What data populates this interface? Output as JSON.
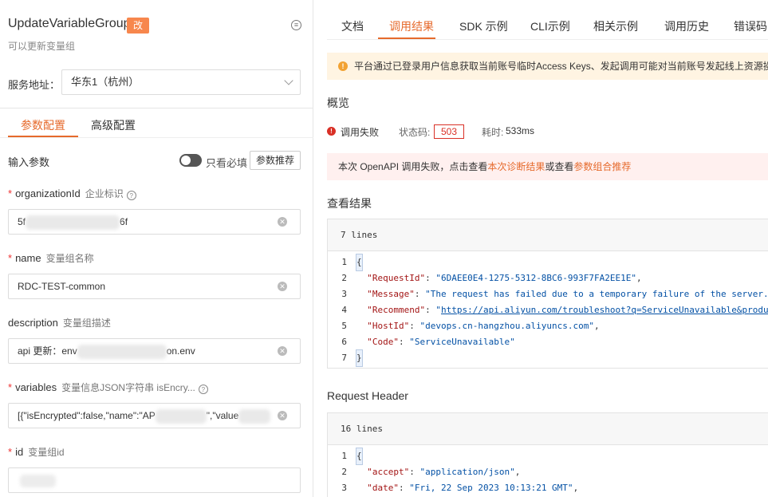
{
  "left": {
    "api_name": "UpdateVariableGroup",
    "tag": "改",
    "description": "可以更新变量组",
    "service": {
      "label": "服务地址：",
      "value": "华东1（杭州）"
    },
    "tabs": [
      "参数配置",
      "高级配置"
    ],
    "input_title": "输入参数",
    "required_only": "只看必填",
    "recommend_button": "参数推荐",
    "params": [
      {
        "required": true,
        "name": "organizationId",
        "desc": "企业标识",
        "help": true,
        "value_start": "5f",
        "value_end": "6f"
      },
      {
        "required": true,
        "name": "name",
        "desc": "变量组名称",
        "help": false,
        "value_start": "RDC-TEST-common",
        "value_end": ""
      },
      {
        "required": false,
        "name": "description",
        "desc": "变量组描述",
        "help": false,
        "value_start": "api 更新：env",
        "value_end": "on.env"
      },
      {
        "required": true,
        "name": "variables",
        "desc": "变量信息JSON字符串 isEncry...",
        "help": true,
        "value_start": "[{\"isEncrypted\":false,\"name\":\"AP",
        "value_mid": "\",\"value",
        "value_end": ""
      },
      {
        "required": true,
        "name": "id",
        "desc": "变量组id",
        "help": false,
        "value_start": "",
        "value_end": ""
      }
    ]
  },
  "right": {
    "tabs": [
      "文档",
      "调用结果",
      "SDK 示例",
      "CLI示例",
      "相关示例",
      "调用历史",
      "错误码"
    ],
    "active_tab": "调用结果",
    "notice": "平台通过已登录用户信息获取当前账号临时Access Keys、发起调用可能对当前账号发起线上资源操",
    "overview_title": "概览",
    "status_text": "调用失败",
    "status_code_label": "状态码:",
    "status_code": "503",
    "time_label": "耗时:",
    "time_value": "533ms",
    "banner": {
      "prefix": "本次 OpenAPI 调用失败，点击查看",
      "link1": "本次诊断结果",
      "mid": "或查看",
      "link2": "参数组合推荐"
    },
    "result_title": "查看结果",
    "result_lines": "7 lines",
    "result_code": {
      "open": "{",
      "rows": [
        {
          "key": "\"RequestId\"",
          "val": "\"6DAEE0E4-1275-5312-8BC6-993F7FA2EE1E\"",
          "tail": ","
        },
        {
          "key": "\"Message\"",
          "val": "\"The request has failed due to a temporary failure of the server.",
          "tail": ""
        },
        {
          "key": "\"Recommend\"",
          "val": "https://api.aliyun.com/troubleshoot?q=ServiceUnavailable&produ",
          "tail": ""
        },
        {
          "key": "\"HostId\"",
          "val": "\"devops.cn-hangzhou.aliyuncs.com\"",
          "tail": ","
        },
        {
          "key": "\"Code\"",
          "val": "\"ServiceUnavailable\"",
          "tail": ""
        }
      ],
      "close": "}"
    },
    "header_title": "Request Header",
    "header_lines": "16 lines",
    "header_code": {
      "open": "{",
      "rows": [
        {
          "key": "\"accept\"",
          "val": "\"application/json\"",
          "tail": ","
        },
        {
          "key": "\"date\"",
          "val": "\"Fri, 22 Sep 2023 10:13:21 GMT\"",
          "tail": ","
        }
      ]
    },
    "colors": {
      "accent": "#e66a2c",
      "error": "#d93026",
      "warning": "#f2a233"
    }
  }
}
